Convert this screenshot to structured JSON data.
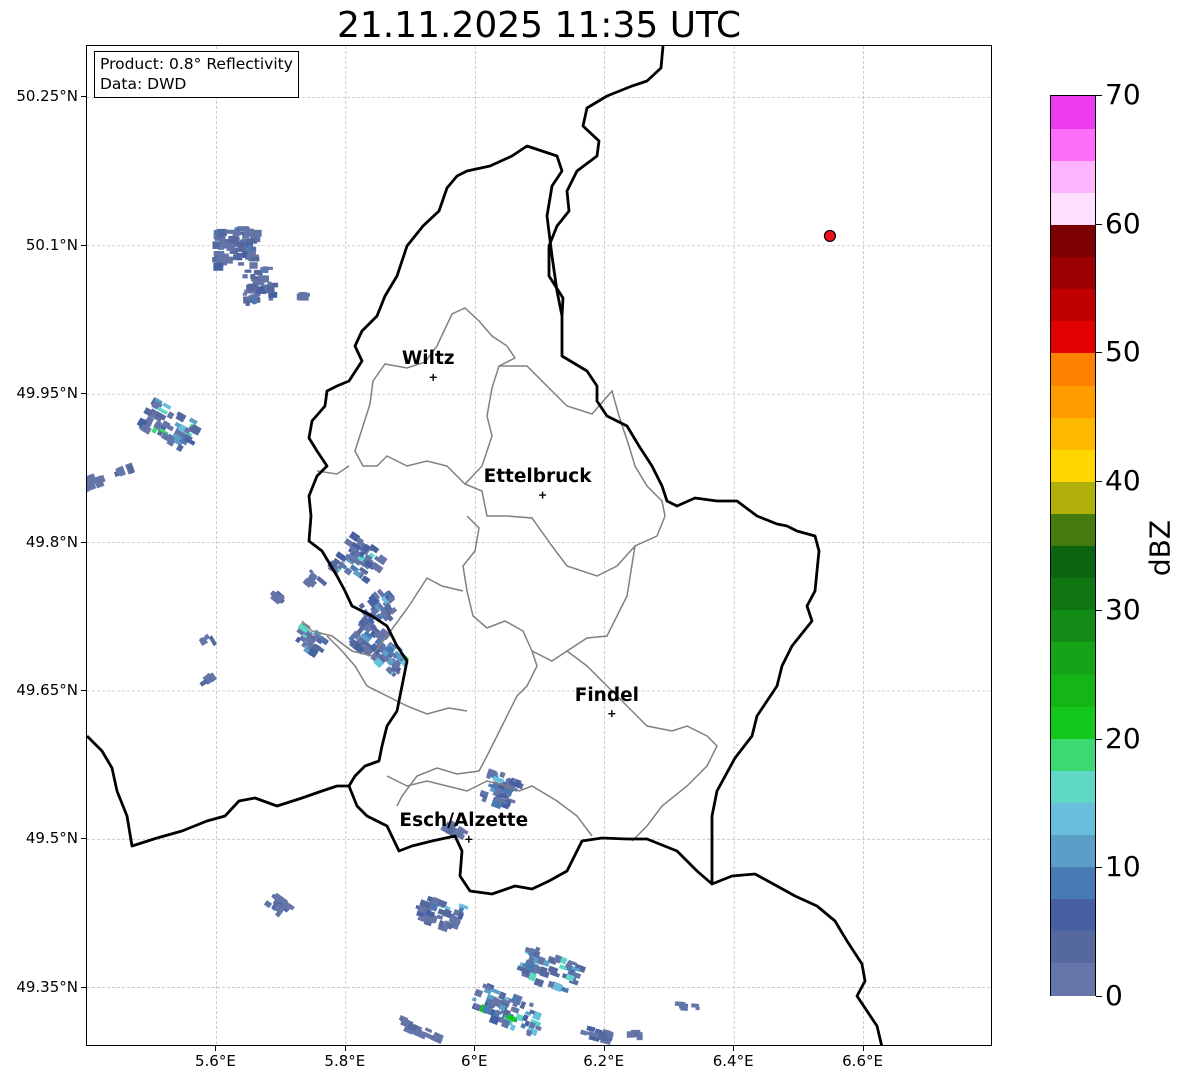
{
  "title": "21.11.2025 11:35 UTC",
  "info_box": {
    "product": "Product: 0.8° Reflectivity",
    "data": "Data: DWD"
  },
  "lat_labels": [
    "50.25°N",
    "50.1°N",
    "49.95°N",
    "49.8°N",
    "49.65°N",
    "49.5°N",
    "49.35°N"
  ],
  "lon_labels": [
    "5.6°E",
    "5.8°E",
    "6°E",
    "6.2°E",
    "6.4°E",
    "6.6°E"
  ],
  "cities": [
    {
      "name": "Wiltz",
      "lon": 5.935,
      "lat": 49.967
    },
    {
      "name": "Ettelbruck",
      "lon": 6.104,
      "lat": 49.848
    },
    {
      "name": "Findel",
      "lon": 6.211,
      "lat": 49.627
    },
    {
      "name": "Esch/Alzette",
      "lon": 5.99,
      "lat": 49.5
    }
  ],
  "radar_site_marker": {
    "lon": 6.548,
    "lat": 50.11,
    "color": "#e8141c"
  },
  "colorbar": {
    "unit": "dBZ",
    "min": 0,
    "max": 70,
    "tick_labels": [
      "0",
      "10",
      "20",
      "30",
      "40",
      "50",
      "60",
      "70"
    ],
    "colors": [
      "#6575a8",
      "#56699f",
      "#4760a2",
      "#4a7ab3",
      "#5b9fc9",
      "#69c0dd",
      "#5ed8c5",
      "#3ed873",
      "#12c81a",
      "#14b616",
      "#15a318",
      "#128c17",
      "#0f7612",
      "#0a6410",
      "#457a0e",
      "#b1b00b",
      "#fed600",
      "#fdb800",
      "#ff9d00",
      "#fe8101",
      "#e20000",
      "#c00000",
      "#9d0000",
      "#7c0000",
      "#fde0fe",
      "#fdb3fd",
      "#fd6ffb",
      "#ec3aee"
    ]
  },
  "map_extent": {
    "lon_min": 5.4,
    "lon_max": 6.8,
    "lat_min": 49.29,
    "lat_max": 50.302
  }
}
